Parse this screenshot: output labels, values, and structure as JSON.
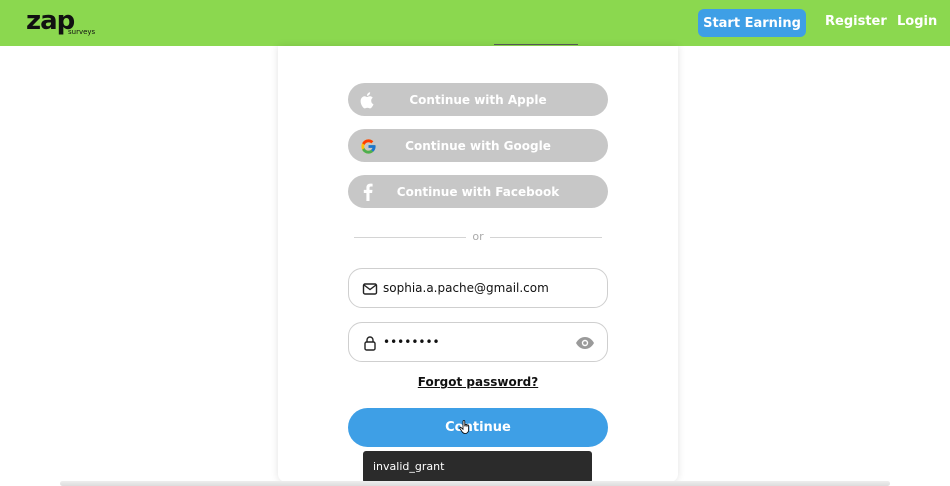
{
  "header": {
    "logo_main": "zap",
    "logo_sub": "surveys",
    "start_earning_label": "Start Earning",
    "register_label": "Register",
    "login_label": "Login"
  },
  "social": {
    "apple_label": "Continue with Apple",
    "google_label": "Continue with Google",
    "facebook_label": "Continue with Facebook"
  },
  "divider_text": "or",
  "form": {
    "email_value": "sophia.a.pache@gmail.com",
    "password_value": "••••••••",
    "forgot_label": "Forgot password?",
    "continue_label": "Continue"
  },
  "toast": {
    "message": "invalid_grant"
  },
  "colors": {
    "topbar": "#8bd84f",
    "primary": "#3e9fe6",
    "social_button": "#c7c7c7"
  }
}
